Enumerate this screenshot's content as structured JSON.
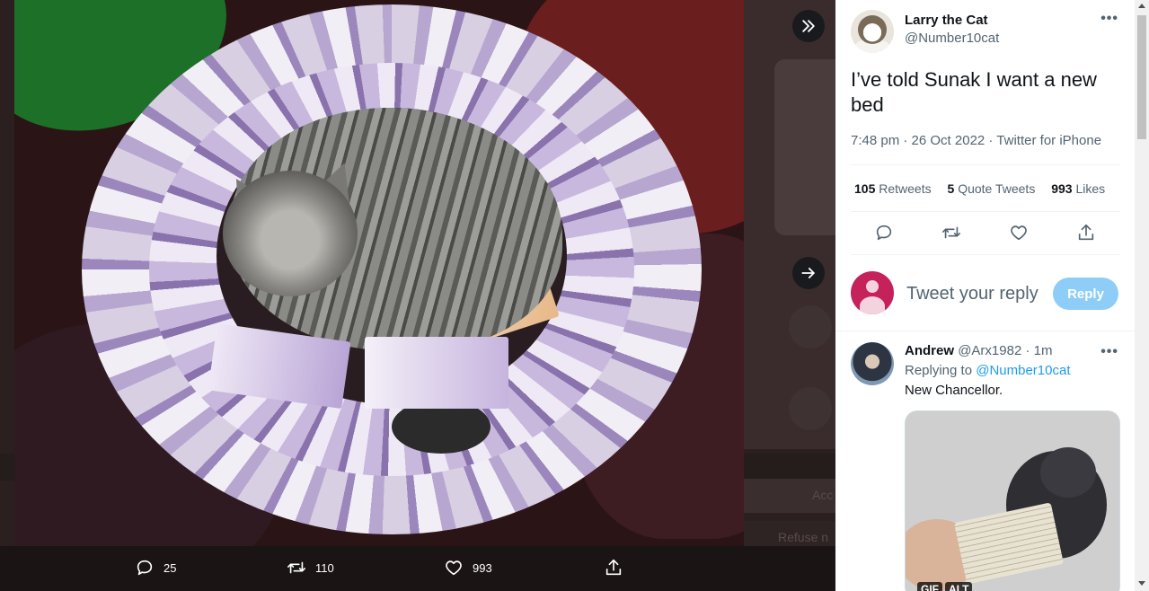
{
  "viewer": {
    "bg_button_1": "Acc",
    "bg_button_2": "Refuse n",
    "actions": {
      "reply_count": "25",
      "retweet_count": "110",
      "like_count": "993"
    }
  },
  "tweet": {
    "author_name": "Larry the Cat",
    "author_handle": "@Number10cat",
    "text": "I’ve told Sunak I want a new bed",
    "meta": "7:48 pm · 26 Oct 2022 · Twitter for iPhone",
    "stats": {
      "retweets_count": "105",
      "retweets_label": "Retweets",
      "quotes_count": "5",
      "quotes_label": "Quote Tweets",
      "likes_count": "993",
      "likes_label": "Likes"
    }
  },
  "reply_composer": {
    "placeholder": "Tweet your reply",
    "button_label": "Reply"
  },
  "reply": {
    "author_name": "Andrew",
    "author_handle_time": "@Arx1982 · 1m",
    "replying_to_label": "Replying to",
    "replying_to_handle": "@Number10cat",
    "text": "New Chancellor.",
    "media_badges": [
      "GIF",
      "ALT"
    ]
  },
  "colors": {
    "accent": "#1d9bf0",
    "reply_button_disabled": "#8ecdf8",
    "text_primary": "#0f1419",
    "text_secondary": "#536471"
  },
  "icons": [
    "collapse-icon",
    "arrow-right-icon",
    "reply-icon",
    "retweet-icon",
    "like-icon",
    "share-icon",
    "more-icon"
  ]
}
